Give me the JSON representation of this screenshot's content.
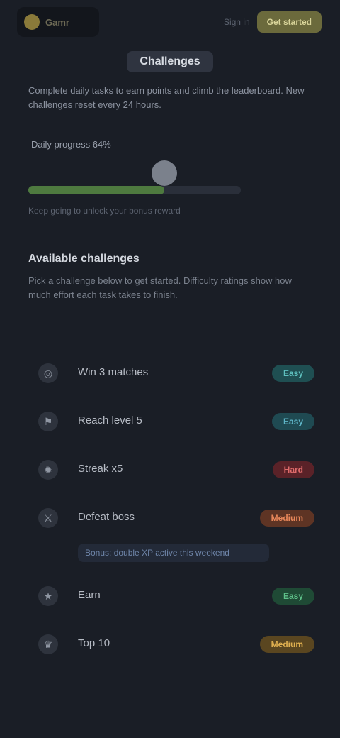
{
  "topbar": {
    "logo_text": "Gamr",
    "link": "Sign in",
    "button": "Get started"
  },
  "header": {
    "title": "Challenges"
  },
  "intro": "Complete daily tasks to earn points and climb the leaderboard. New challenges reset every 24 hours.",
  "progress": {
    "label": "Daily progress 64%",
    "value": 0.64,
    "note": "Keep going to unlock your bonus reward"
  },
  "section": {
    "title": "Available challenges",
    "description": "Pick a challenge below to get started. Difficulty ratings show how much effort each task takes to finish."
  },
  "items": [
    {
      "icon": "target-icon",
      "label": "Win 3 matches",
      "badge": "Easy",
      "color": "#1f4f52",
      "text_color": "#5fc2c0"
    },
    {
      "icon": "flag-icon",
      "label": "Reach level 5",
      "badge": "Easy",
      "color": "#1f4a52",
      "text_color": "#5fb6c8"
    },
    {
      "icon": "fire-icon",
      "label": "Streak x5",
      "badge": "Hard",
      "color": "#5a2228",
      "text_color": "#e06b6b"
    },
    {
      "icon": "sword-icon",
      "label": "Defeat boss",
      "badge": "Medium",
      "color": "#5e3424",
      "text_color": "#e8875a",
      "sub": "Bonus: double XP active this weekend"
    },
    {
      "icon": "star-icon",
      "label": "Earn",
      "badge": "Easy",
      "color": "#1f4a35",
      "text_color": "#5fc28a"
    },
    {
      "icon": "trophy-icon",
      "label": "Top 10",
      "badge": "Medium",
      "color": "#5a4620",
      "text_color": "#e0b050"
    }
  ]
}
